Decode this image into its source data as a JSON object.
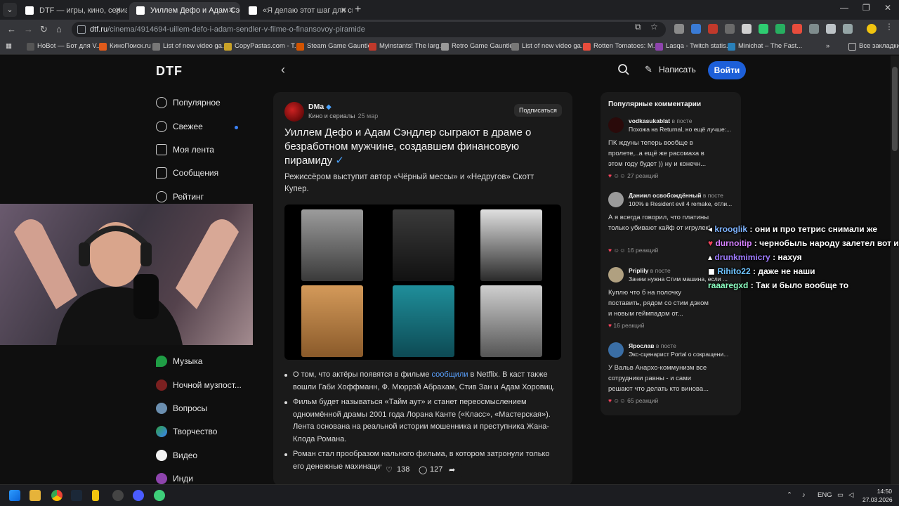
{
  "browser": {
    "tabs": [
      {
        "title": "DTF — игры, кино, сериалы, р",
        "active": false
      },
      {
        "title": "Уиллем Дефо и Адам Сэндлер",
        "active": true
      },
      {
        "title": "«Я делаю этот шаг для своей",
        "active": false
      }
    ],
    "url_host": "dtf.ru",
    "url_path": "/cinema/4914694-uillem-defo-i-adam-sendler-v-filme-o-finansovoy-piramide",
    "bookmarks": [
      "HoBot — Бот для V...",
      "КиноПоиск.ru",
      "List of new video ga...",
      "CopyPastas.com - T...",
      "Steam Game Gauntlet",
      "Myinstants! The larg...",
      "Retro Game Gauntlet",
      "List of new video ga...",
      "Rotten Tomatoes: M...",
      "Lasqa - Twitch statis...",
      "Minichat – The Fast..."
    ],
    "all_bookmarks": "Все закладки"
  },
  "header": {
    "logo": "DTF",
    "write": "Написать",
    "login": "Войти"
  },
  "sidebar": {
    "items_top": [
      "Популярное",
      "Свежее",
      "Моя лента",
      "Сообщения",
      "Рейтинг"
    ],
    "items_bottom": [
      "Музыка",
      "Ночной музпост...",
      "Вопросы",
      "Творчество",
      "Видео",
      "Инди"
    ]
  },
  "article": {
    "author": "DMa",
    "category": "Кино и сериалы",
    "date": "25 мар",
    "subscribe": "Подписаться",
    "title": "Уиллем Дефо и Адам Сэндлер сыграют в драме о безработном мужчине, создавшем финансовую пирамиду",
    "lead": "Режиссёром выступит автор «Чёрный мессы» и «Недругов» Скотт Купер.",
    "bullet1_a": "О том, что актёры появятся в фильме ",
    "bullet1_link": "сообщили",
    "bullet1_b": " в Netflix. В каст также вошли Габи Хоффманн, Ф. Мюррэй Абрахам, Стив Зан и Адам Хоровиц.",
    "bullet2": "Фильм будет называться «Тайм аут» и станет переосмыслением одноимённой драмы 2001 года Лорана Канте («Класс», «Мастерская»). Лента основана на реальной истории мошенника и преступника Жана-Клода Романа.",
    "bullet3": "Роман стал прообразом                    нального фильма, в котором затронули только его денежные махинации вроде создания",
    "likes": "138",
    "comments": "127"
  },
  "popular": {
    "title": "Популярные комментарии",
    "in_post": "в посте",
    "comments": [
      {
        "user": "vodkasukablat",
        "post": "Похожа на Returnal, но ещё лучше:...",
        "text": "ПК ждуны теперь вообще в пролете,..а ещё же расомаха в этом году будет )) ну и конечн...",
        "reactions": "27 реакций"
      },
      {
        "user": "Даниил освобождённый",
        "post": "100% в Resident evil 4 remake, отли...",
        "text": "А я всегда говорил, что платины только убивают кайф от игрулек!",
        "reactions": "16 реакций"
      },
      {
        "user": "Priplily",
        "post": "Зачем нужна Стим машина, если ...",
        "text": "Куплю что б на полочку поставить, рядом со стим дэком и новым геймпадом от...",
        "reactions": "16 реакций"
      },
      {
        "user": "Ярослав",
        "post": "Экс-сценарист Portal о сокращени...",
        "text": "У Вальв Анархо-коммунизм все сотрудники равны - и сами решают что делать кто винова...",
        "reactions": "65 реакций"
      }
    ]
  },
  "chat": [
    {
      "user": "krooglik",
      "msg": "они и про тетрис снимали же"
    },
    {
      "user": "durnoitip",
      "msg": "чернобыль народу залетел вот и сняли"
    },
    {
      "user": "drunkmimicry",
      "msg": "нахуя"
    },
    {
      "user": "Rihito22",
      "msg": "даже не наши"
    },
    {
      "user": "raaaregxd",
      "msg": "Так и было вообще то"
    }
  ],
  "taskbar": {
    "lang": "ENG",
    "time": "14:50",
    "date": "27.03.2026"
  },
  "colors": {
    "accent": "#1d5fd8",
    "link": "#5aa2ff",
    "heart": "#f2425b"
  }
}
